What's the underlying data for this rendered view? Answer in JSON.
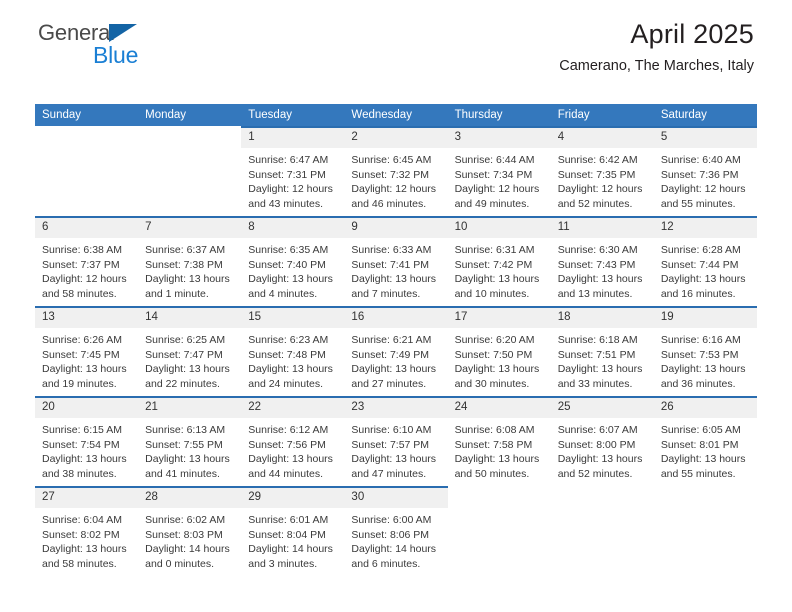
{
  "brand": {
    "name_part1": "General",
    "name_part2": "Blue",
    "triangle_color": "#1464a5",
    "blue_color": "#1a7fd4"
  },
  "header": {
    "title": "April 2025",
    "location": "Camerano, The Marches, Italy"
  },
  "theme": {
    "header_blue": "#3478bd",
    "row_rule_blue": "#2a6db0",
    "daynum_background": "#f0f0f0"
  },
  "calendar": {
    "weekday_headers": [
      "Sunday",
      "Monday",
      "Tuesday",
      "Wednesday",
      "Thursday",
      "Friday",
      "Saturday"
    ],
    "weeks": [
      [
        {
          "day": "",
          "sunrise": "",
          "sunset": "",
          "daylight": ""
        },
        {
          "day": "",
          "sunrise": "",
          "sunset": "",
          "daylight": ""
        },
        {
          "day": "1",
          "sunrise": "Sunrise: 6:47 AM",
          "sunset": "Sunset: 7:31 PM",
          "daylight": "Daylight: 12 hours and 43 minutes."
        },
        {
          "day": "2",
          "sunrise": "Sunrise: 6:45 AM",
          "sunset": "Sunset: 7:32 PM",
          "daylight": "Daylight: 12 hours and 46 minutes."
        },
        {
          "day": "3",
          "sunrise": "Sunrise: 6:44 AM",
          "sunset": "Sunset: 7:34 PM",
          "daylight": "Daylight: 12 hours and 49 minutes."
        },
        {
          "day": "4",
          "sunrise": "Sunrise: 6:42 AM",
          "sunset": "Sunset: 7:35 PM",
          "daylight": "Daylight: 12 hours and 52 minutes."
        },
        {
          "day": "5",
          "sunrise": "Sunrise: 6:40 AM",
          "sunset": "Sunset: 7:36 PM",
          "daylight": "Daylight: 12 hours and 55 minutes."
        }
      ],
      [
        {
          "day": "6",
          "sunrise": "Sunrise: 6:38 AM",
          "sunset": "Sunset: 7:37 PM",
          "daylight": "Daylight: 12 hours and 58 minutes."
        },
        {
          "day": "7",
          "sunrise": "Sunrise: 6:37 AM",
          "sunset": "Sunset: 7:38 PM",
          "daylight": "Daylight: 13 hours and 1 minute."
        },
        {
          "day": "8",
          "sunrise": "Sunrise: 6:35 AM",
          "sunset": "Sunset: 7:40 PM",
          "daylight": "Daylight: 13 hours and 4 minutes."
        },
        {
          "day": "9",
          "sunrise": "Sunrise: 6:33 AM",
          "sunset": "Sunset: 7:41 PM",
          "daylight": "Daylight: 13 hours and 7 minutes."
        },
        {
          "day": "10",
          "sunrise": "Sunrise: 6:31 AM",
          "sunset": "Sunset: 7:42 PM",
          "daylight": "Daylight: 13 hours and 10 minutes."
        },
        {
          "day": "11",
          "sunrise": "Sunrise: 6:30 AM",
          "sunset": "Sunset: 7:43 PM",
          "daylight": "Daylight: 13 hours and 13 minutes."
        },
        {
          "day": "12",
          "sunrise": "Sunrise: 6:28 AM",
          "sunset": "Sunset: 7:44 PM",
          "daylight": "Daylight: 13 hours and 16 minutes."
        }
      ],
      [
        {
          "day": "13",
          "sunrise": "Sunrise: 6:26 AM",
          "sunset": "Sunset: 7:45 PM",
          "daylight": "Daylight: 13 hours and 19 minutes."
        },
        {
          "day": "14",
          "sunrise": "Sunrise: 6:25 AM",
          "sunset": "Sunset: 7:47 PM",
          "daylight": "Daylight: 13 hours and 22 minutes."
        },
        {
          "day": "15",
          "sunrise": "Sunrise: 6:23 AM",
          "sunset": "Sunset: 7:48 PM",
          "daylight": "Daylight: 13 hours and 24 minutes."
        },
        {
          "day": "16",
          "sunrise": "Sunrise: 6:21 AM",
          "sunset": "Sunset: 7:49 PM",
          "daylight": "Daylight: 13 hours and 27 minutes."
        },
        {
          "day": "17",
          "sunrise": "Sunrise: 6:20 AM",
          "sunset": "Sunset: 7:50 PM",
          "daylight": "Daylight: 13 hours and 30 minutes."
        },
        {
          "day": "18",
          "sunrise": "Sunrise: 6:18 AM",
          "sunset": "Sunset: 7:51 PM",
          "daylight": "Daylight: 13 hours and 33 minutes."
        },
        {
          "day": "19",
          "sunrise": "Sunrise: 6:16 AM",
          "sunset": "Sunset: 7:53 PM",
          "daylight": "Daylight: 13 hours and 36 minutes."
        }
      ],
      [
        {
          "day": "20",
          "sunrise": "Sunrise: 6:15 AM",
          "sunset": "Sunset: 7:54 PM",
          "daylight": "Daylight: 13 hours and 38 minutes."
        },
        {
          "day": "21",
          "sunrise": "Sunrise: 6:13 AM",
          "sunset": "Sunset: 7:55 PM",
          "daylight": "Daylight: 13 hours and 41 minutes."
        },
        {
          "day": "22",
          "sunrise": "Sunrise: 6:12 AM",
          "sunset": "Sunset: 7:56 PM",
          "daylight": "Daylight: 13 hours and 44 minutes."
        },
        {
          "day": "23",
          "sunrise": "Sunrise: 6:10 AM",
          "sunset": "Sunset: 7:57 PM",
          "daylight": "Daylight: 13 hours and 47 minutes."
        },
        {
          "day": "24",
          "sunrise": "Sunrise: 6:08 AM",
          "sunset": "Sunset: 7:58 PM",
          "daylight": "Daylight: 13 hours and 50 minutes."
        },
        {
          "day": "25",
          "sunrise": "Sunrise: 6:07 AM",
          "sunset": "Sunset: 8:00 PM",
          "daylight": "Daylight: 13 hours and 52 minutes."
        },
        {
          "day": "26",
          "sunrise": "Sunrise: 6:05 AM",
          "sunset": "Sunset: 8:01 PM",
          "daylight": "Daylight: 13 hours and 55 minutes."
        }
      ],
      [
        {
          "day": "27",
          "sunrise": "Sunrise: 6:04 AM",
          "sunset": "Sunset: 8:02 PM",
          "daylight": "Daylight: 13 hours and 58 minutes."
        },
        {
          "day": "28",
          "sunrise": "Sunrise: 6:02 AM",
          "sunset": "Sunset: 8:03 PM",
          "daylight": "Daylight: 14 hours and 0 minutes."
        },
        {
          "day": "29",
          "sunrise": "Sunrise: 6:01 AM",
          "sunset": "Sunset: 8:04 PM",
          "daylight": "Daylight: 14 hours and 3 minutes."
        },
        {
          "day": "30",
          "sunrise": "Sunrise: 6:00 AM",
          "sunset": "Sunset: 8:06 PM",
          "daylight": "Daylight: 14 hours and 6 minutes."
        },
        {
          "day": "",
          "sunrise": "",
          "sunset": "",
          "daylight": ""
        },
        {
          "day": "",
          "sunrise": "",
          "sunset": "",
          "daylight": ""
        },
        {
          "day": "",
          "sunrise": "",
          "sunset": "",
          "daylight": ""
        }
      ]
    ]
  }
}
